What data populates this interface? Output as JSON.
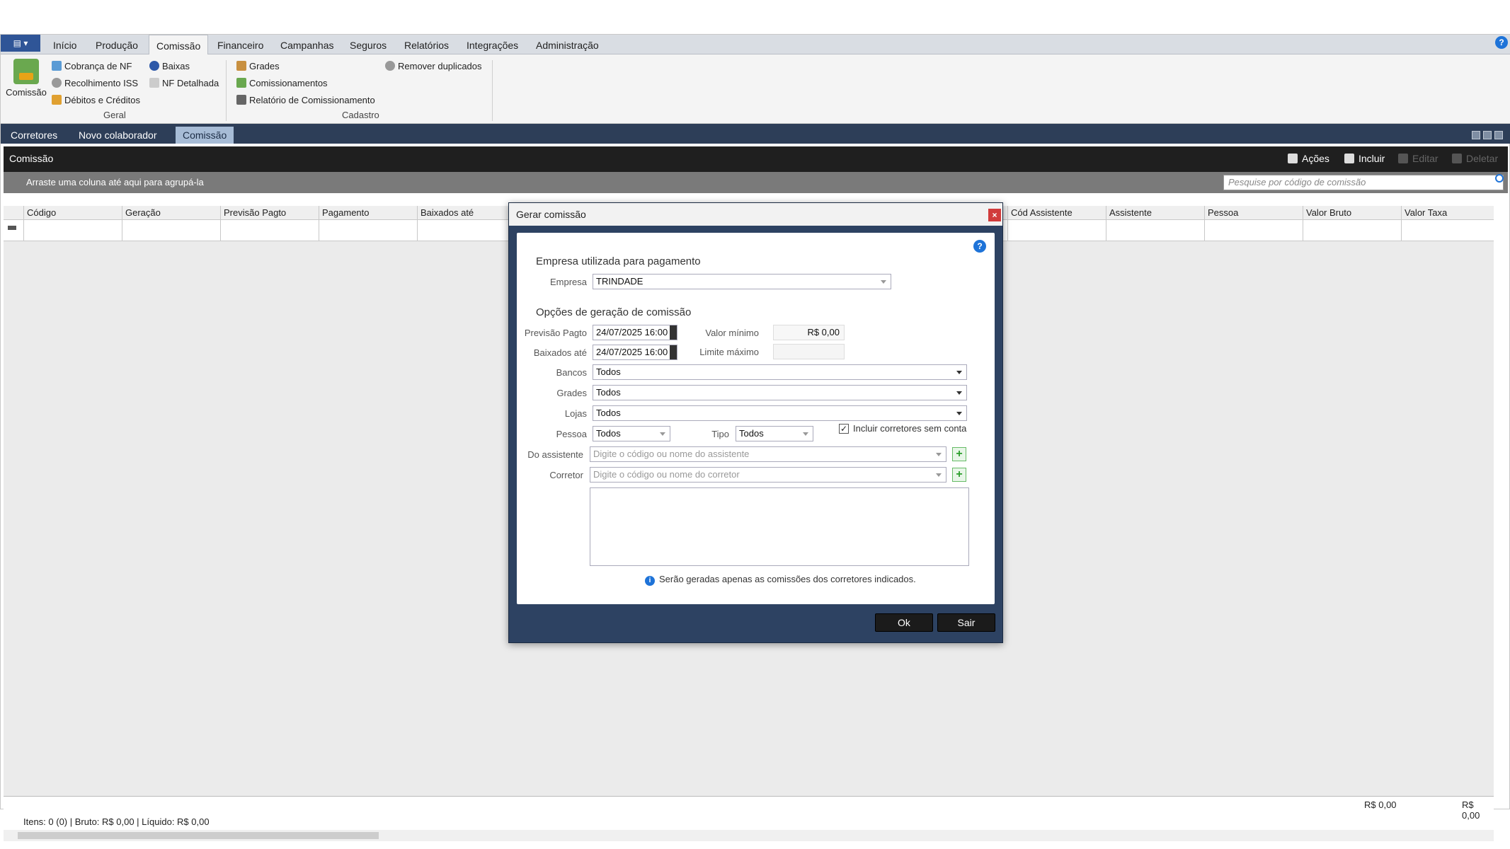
{
  "menu": {
    "app_label": "▤ ▾",
    "items": [
      "Início",
      "Produção",
      "Comissão",
      "Financeiro",
      "Campanhas",
      "Seguros",
      "Relatórios",
      "Integrações",
      "Administração"
    ],
    "active": "Comissão"
  },
  "ribbon": {
    "big": "Comissão",
    "geral": [
      "Cobrança de NF",
      "Recolhimento ISS",
      "Débitos e Créditos",
      "Baixas",
      "NF Detalhada"
    ],
    "cadastro": [
      "Grades",
      "Comissionamentos",
      "Relatório de Comissionamento",
      "Remover duplicados"
    ],
    "group_geral": "Geral",
    "group_cadastro": "Cadastro"
  },
  "tabs": [
    "Corretores",
    "Novo colaborador",
    "Comissão"
  ],
  "panel": {
    "title": "Comissão",
    "actions": "Ações",
    "include": "Incluir",
    "edit": "Editar",
    "delete": "Deletar",
    "group_hint": "Arraste uma coluna até aqui para agrupá-la",
    "search_placeholder": "Pesquise por código de comissão"
  },
  "grid": {
    "columns_left": [
      "Código",
      "Geração",
      "Previsão Pagto",
      "Pagamento",
      "Baixados até"
    ],
    "columns_right": [
      "Cód Assistente",
      "Assistente",
      "Pessoa",
      "Valor Bruto",
      "Valor Taxa"
    ],
    "footer_bruto": "R$ 0,00",
    "footer_taxa": "R$ 0,00",
    "status": "Itens: 0 (0) | Bruto: R$ 0,00 | Líquido: R$ 0,00"
  },
  "dialog": {
    "title": "Gerar comissão",
    "close": "×",
    "section1": "Empresa utilizada para pagamento",
    "empresa_label": "Empresa",
    "empresa_value": "TRINDADE",
    "section2": "Opções de geração de comissão",
    "previsao_label": "Previsão Pagto",
    "previsao_value": "24/07/2025 16:00",
    "baixados_label": "Baixados até",
    "baixados_value": "24/07/2025 16:00",
    "valor_min_label": "Valor mínimo",
    "valor_min_value": "R$ 0,00",
    "limite_label": "Limite máximo",
    "limite_value": "",
    "bancos_label": "Bancos",
    "bancos_value": "Todos",
    "grades_label": "Grades",
    "grades_value": "Todos",
    "lojas_label": "Lojas",
    "lojas_value": "Todos",
    "pessoa_label": "Pessoa",
    "pessoa_value": "Todos",
    "tipo_label": "Tipo",
    "tipo_value": "Todos",
    "incluir_label": "Incluir corretores sem conta",
    "incluir_checked": true,
    "assistente_label": "Do assistente",
    "assistente_placeholder": "Digite o código ou nome do assistente",
    "corretor_label": "Corretor",
    "corretor_placeholder": "Digite o código ou nome do corretor",
    "info": "Serão geradas apenas as comissões dos corretores indicados.",
    "ok": "Ok",
    "sair": "Sair"
  }
}
